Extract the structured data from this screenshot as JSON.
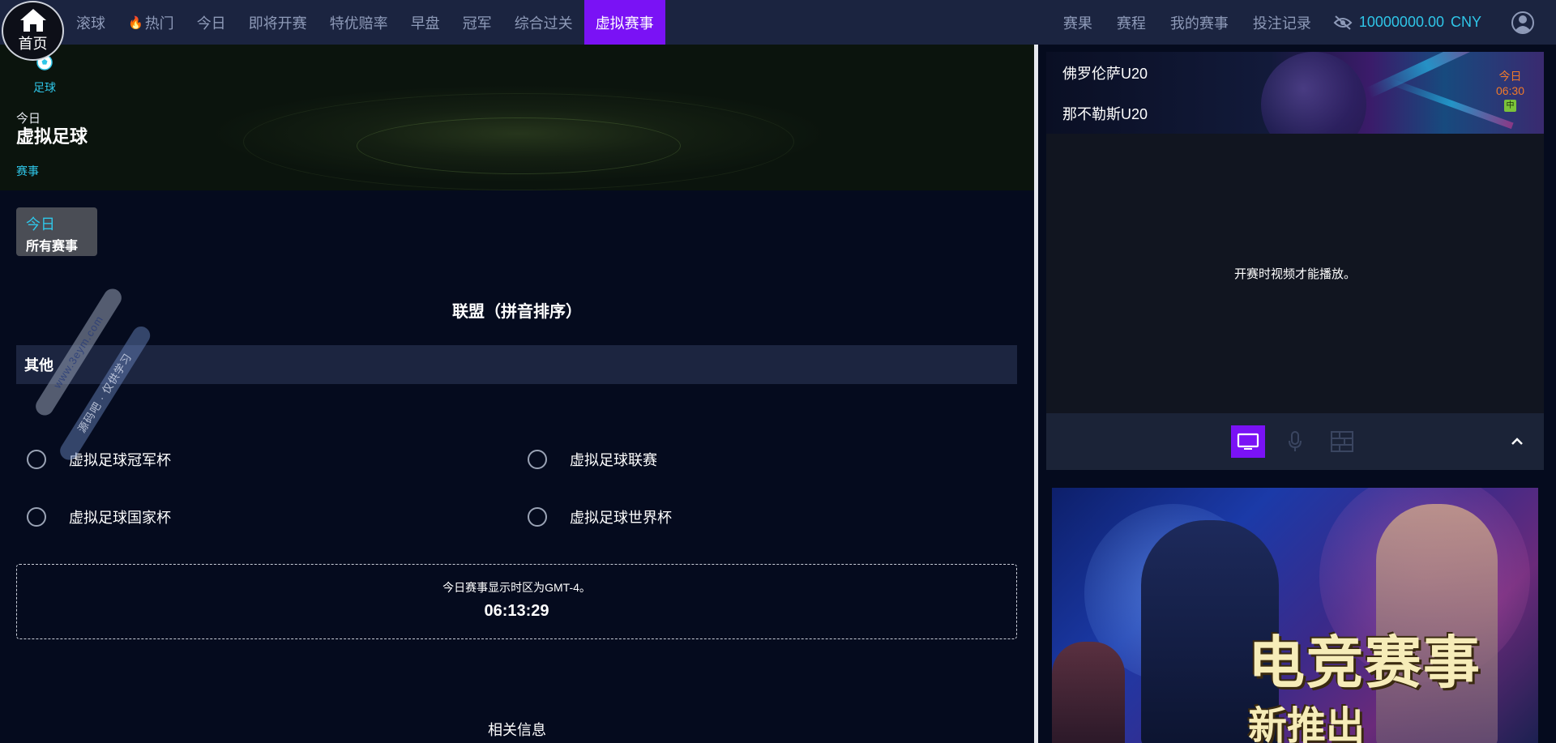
{
  "home": {
    "label": "首页"
  },
  "nav": {
    "left": [
      {
        "label": "滚球",
        "active": false
      },
      {
        "label": "热门",
        "active": false,
        "icon": "fire-icon"
      },
      {
        "label": "今日",
        "active": false
      },
      {
        "label": "即将开赛",
        "active": false
      },
      {
        "label": "特优赔率",
        "active": false
      },
      {
        "label": "早盘",
        "active": false
      },
      {
        "label": "冠军",
        "active": false
      },
      {
        "label": "综合过关",
        "active": false
      },
      {
        "label": "虚拟赛事",
        "active": true
      }
    ],
    "right": [
      {
        "label": "赛果"
      },
      {
        "label": "赛程"
      },
      {
        "label": "我的赛事"
      },
      {
        "label": "投注记录"
      }
    ],
    "balance": {
      "amount": "10000000.00",
      "currency": "CNY"
    },
    "accent": "#7a12f5",
    "balance_color": "#2fc6e8"
  },
  "hero": {
    "sport_tab": {
      "label": "足球",
      "icon": "soccer-ball-icon"
    },
    "day": "今日",
    "title": "虚拟足球",
    "events_link": "赛事"
  },
  "filter": {
    "day": "今日",
    "label": "所有赛事"
  },
  "league_heading": "联盟（拼音排序）",
  "group": {
    "name": "其他"
  },
  "leagues": [
    {
      "name": "虚拟足球冠军杯"
    },
    {
      "name": "虚拟足球联赛"
    },
    {
      "name": "虚拟足球国家杯"
    },
    {
      "name": "虚拟足球世界杯"
    }
  ],
  "timezone_note": "今日赛事显示时区为GMT-4。",
  "clock": "06:13:29",
  "related": "相关信息",
  "watermark": {
    "line1": "www.3eym.com",
    "line2": "源码吧 · 仅供学习"
  },
  "side": {
    "match": {
      "home": "佛罗伦萨U20",
      "away": "那不勒斯U20",
      "day": "今日",
      "time": "06:30",
      "badge": "中"
    },
    "video_message": "开赛时视频才能播放。",
    "controls": [
      {
        "name": "tv-icon",
        "active": true
      },
      {
        "name": "microphone-icon",
        "active": false
      },
      {
        "name": "scoreboard-icon",
        "active": false
      }
    ],
    "promo": {
      "headline": "电竞赛事",
      "subline": "新推出"
    }
  }
}
